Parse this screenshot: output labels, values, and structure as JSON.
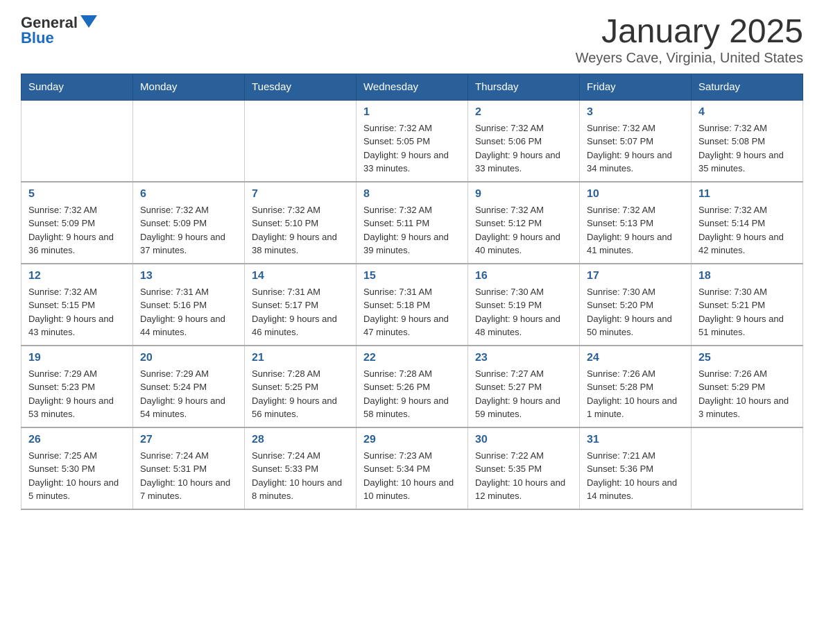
{
  "logo": {
    "general": "General",
    "triangle": "",
    "blue": "Blue"
  },
  "title": "January 2025",
  "subtitle": "Weyers Cave, Virginia, United States",
  "days_of_week": [
    "Sunday",
    "Monday",
    "Tuesday",
    "Wednesday",
    "Thursday",
    "Friday",
    "Saturday"
  ],
  "weeks": [
    [
      {
        "day": "",
        "info": ""
      },
      {
        "day": "",
        "info": ""
      },
      {
        "day": "",
        "info": ""
      },
      {
        "day": "1",
        "info": "Sunrise: 7:32 AM\nSunset: 5:05 PM\nDaylight: 9 hours and 33 minutes."
      },
      {
        "day": "2",
        "info": "Sunrise: 7:32 AM\nSunset: 5:06 PM\nDaylight: 9 hours and 33 minutes."
      },
      {
        "day": "3",
        "info": "Sunrise: 7:32 AM\nSunset: 5:07 PM\nDaylight: 9 hours and 34 minutes."
      },
      {
        "day": "4",
        "info": "Sunrise: 7:32 AM\nSunset: 5:08 PM\nDaylight: 9 hours and 35 minutes."
      }
    ],
    [
      {
        "day": "5",
        "info": "Sunrise: 7:32 AM\nSunset: 5:09 PM\nDaylight: 9 hours and 36 minutes."
      },
      {
        "day": "6",
        "info": "Sunrise: 7:32 AM\nSunset: 5:09 PM\nDaylight: 9 hours and 37 minutes."
      },
      {
        "day": "7",
        "info": "Sunrise: 7:32 AM\nSunset: 5:10 PM\nDaylight: 9 hours and 38 minutes."
      },
      {
        "day": "8",
        "info": "Sunrise: 7:32 AM\nSunset: 5:11 PM\nDaylight: 9 hours and 39 minutes."
      },
      {
        "day": "9",
        "info": "Sunrise: 7:32 AM\nSunset: 5:12 PM\nDaylight: 9 hours and 40 minutes."
      },
      {
        "day": "10",
        "info": "Sunrise: 7:32 AM\nSunset: 5:13 PM\nDaylight: 9 hours and 41 minutes."
      },
      {
        "day": "11",
        "info": "Sunrise: 7:32 AM\nSunset: 5:14 PM\nDaylight: 9 hours and 42 minutes."
      }
    ],
    [
      {
        "day": "12",
        "info": "Sunrise: 7:32 AM\nSunset: 5:15 PM\nDaylight: 9 hours and 43 minutes."
      },
      {
        "day": "13",
        "info": "Sunrise: 7:31 AM\nSunset: 5:16 PM\nDaylight: 9 hours and 44 minutes."
      },
      {
        "day": "14",
        "info": "Sunrise: 7:31 AM\nSunset: 5:17 PM\nDaylight: 9 hours and 46 minutes."
      },
      {
        "day": "15",
        "info": "Sunrise: 7:31 AM\nSunset: 5:18 PM\nDaylight: 9 hours and 47 minutes."
      },
      {
        "day": "16",
        "info": "Sunrise: 7:30 AM\nSunset: 5:19 PM\nDaylight: 9 hours and 48 minutes."
      },
      {
        "day": "17",
        "info": "Sunrise: 7:30 AM\nSunset: 5:20 PM\nDaylight: 9 hours and 50 minutes."
      },
      {
        "day": "18",
        "info": "Sunrise: 7:30 AM\nSunset: 5:21 PM\nDaylight: 9 hours and 51 minutes."
      }
    ],
    [
      {
        "day": "19",
        "info": "Sunrise: 7:29 AM\nSunset: 5:23 PM\nDaylight: 9 hours and 53 minutes."
      },
      {
        "day": "20",
        "info": "Sunrise: 7:29 AM\nSunset: 5:24 PM\nDaylight: 9 hours and 54 minutes."
      },
      {
        "day": "21",
        "info": "Sunrise: 7:28 AM\nSunset: 5:25 PM\nDaylight: 9 hours and 56 minutes."
      },
      {
        "day": "22",
        "info": "Sunrise: 7:28 AM\nSunset: 5:26 PM\nDaylight: 9 hours and 58 minutes."
      },
      {
        "day": "23",
        "info": "Sunrise: 7:27 AM\nSunset: 5:27 PM\nDaylight: 9 hours and 59 minutes."
      },
      {
        "day": "24",
        "info": "Sunrise: 7:26 AM\nSunset: 5:28 PM\nDaylight: 10 hours and 1 minute."
      },
      {
        "day": "25",
        "info": "Sunrise: 7:26 AM\nSunset: 5:29 PM\nDaylight: 10 hours and 3 minutes."
      }
    ],
    [
      {
        "day": "26",
        "info": "Sunrise: 7:25 AM\nSunset: 5:30 PM\nDaylight: 10 hours and 5 minutes."
      },
      {
        "day": "27",
        "info": "Sunrise: 7:24 AM\nSunset: 5:31 PM\nDaylight: 10 hours and 7 minutes."
      },
      {
        "day": "28",
        "info": "Sunrise: 7:24 AM\nSunset: 5:33 PM\nDaylight: 10 hours and 8 minutes."
      },
      {
        "day": "29",
        "info": "Sunrise: 7:23 AM\nSunset: 5:34 PM\nDaylight: 10 hours and 10 minutes."
      },
      {
        "day": "30",
        "info": "Sunrise: 7:22 AM\nSunset: 5:35 PM\nDaylight: 10 hours and 12 minutes."
      },
      {
        "day": "31",
        "info": "Sunrise: 7:21 AM\nSunset: 5:36 PM\nDaylight: 10 hours and 14 minutes."
      },
      {
        "day": "",
        "info": ""
      }
    ]
  ]
}
